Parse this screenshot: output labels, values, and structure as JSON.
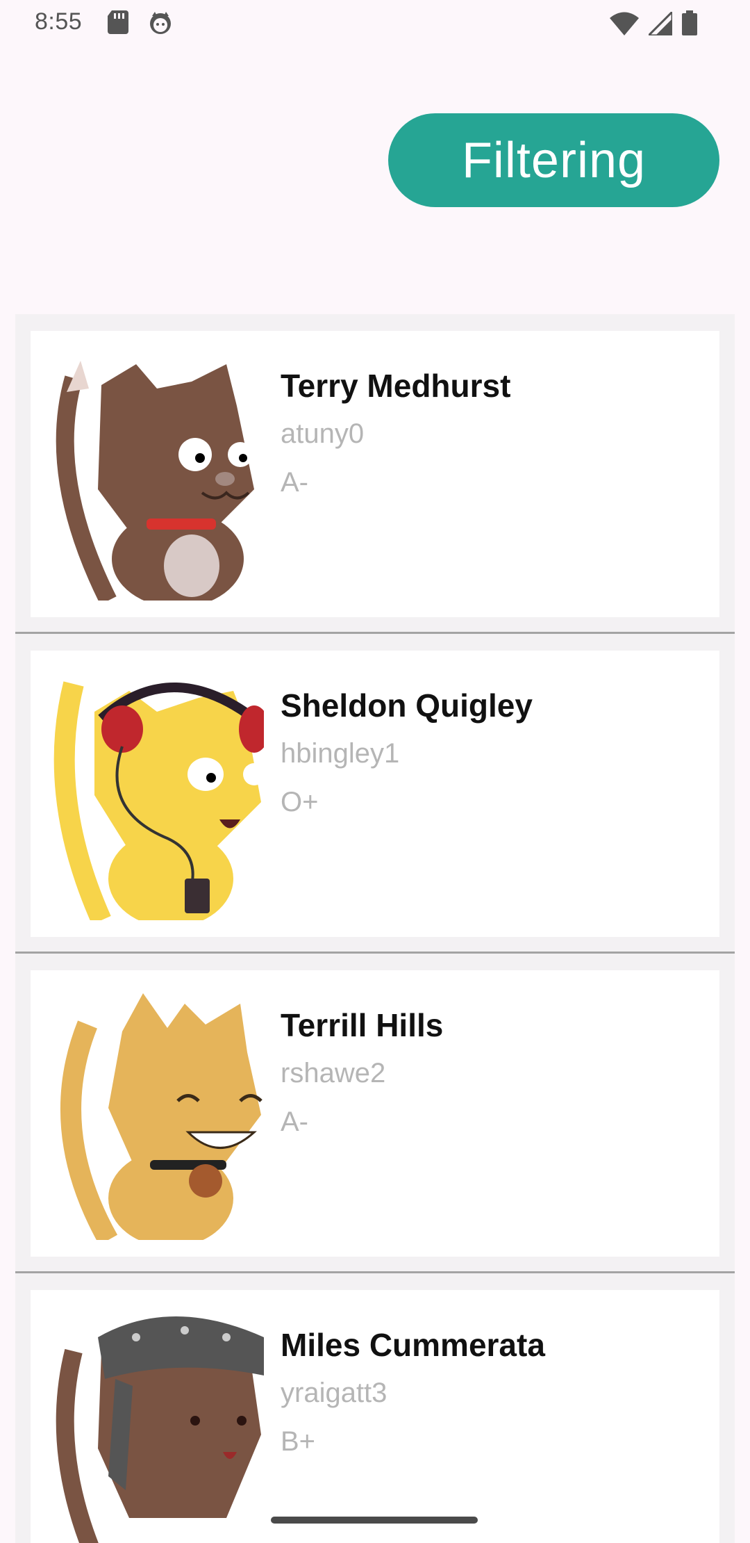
{
  "status_bar": {
    "time": "8:55",
    "left_icons": [
      "sd-card-icon",
      "face-notification-icon"
    ],
    "right_icons": [
      "wifi-icon",
      "cell-signal-icon",
      "battery-icon"
    ]
  },
  "filter_button": {
    "label": "Filtering",
    "color": "#26a594"
  },
  "users": [
    {
      "name": "Terry Medhurst",
      "username": "atuny0",
      "blood_group": "A-",
      "avatar": "brown-cat-avatar"
    },
    {
      "name": "Sheldon Quigley",
      "username": "hbingley1",
      "blood_group": "O+",
      "avatar": "yellow-cat-headphones-avatar"
    },
    {
      "name": "Terrill Hills",
      "username": "rshawe2",
      "blood_group": "A-",
      "avatar": "golden-cat-avatar"
    },
    {
      "name": "Miles Cummerata",
      "username": "yraigatt3",
      "blood_group": "B+",
      "avatar": "brown-cat-bandana-avatar"
    }
  ]
}
